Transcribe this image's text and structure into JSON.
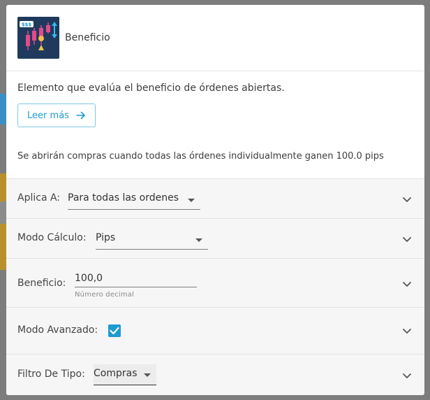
{
  "modal": {
    "title": "Beneficio",
    "logo_text": "$$$",
    "description": "Elemento que evalúa el beneficio de órdenes abiertas.",
    "read_more_label": "Leer más",
    "summary": "Se abrirán compras cuando todas las órdenes individualmente ganen 100.0 pips"
  },
  "fields": {
    "applies_to": {
      "label": "Aplica A:",
      "value": "Para todas las ordenes"
    },
    "calc_mode": {
      "label": "Modo Cálculo:",
      "value": "Pips"
    },
    "profit": {
      "label": "Beneficio:",
      "value": "100,0",
      "hint": "Número decimal"
    },
    "advanced_mode": {
      "label": "Modo Avanzado:",
      "checked": true
    },
    "type_filter": {
      "label": "Filtro De Tipo:",
      "value": "Compras"
    }
  },
  "colors": {
    "accent": "#1e9bd0",
    "logo_bg": "#1f3a5c",
    "row_bg": "#f6f6f6",
    "overlay": "#7d7d7d"
  }
}
